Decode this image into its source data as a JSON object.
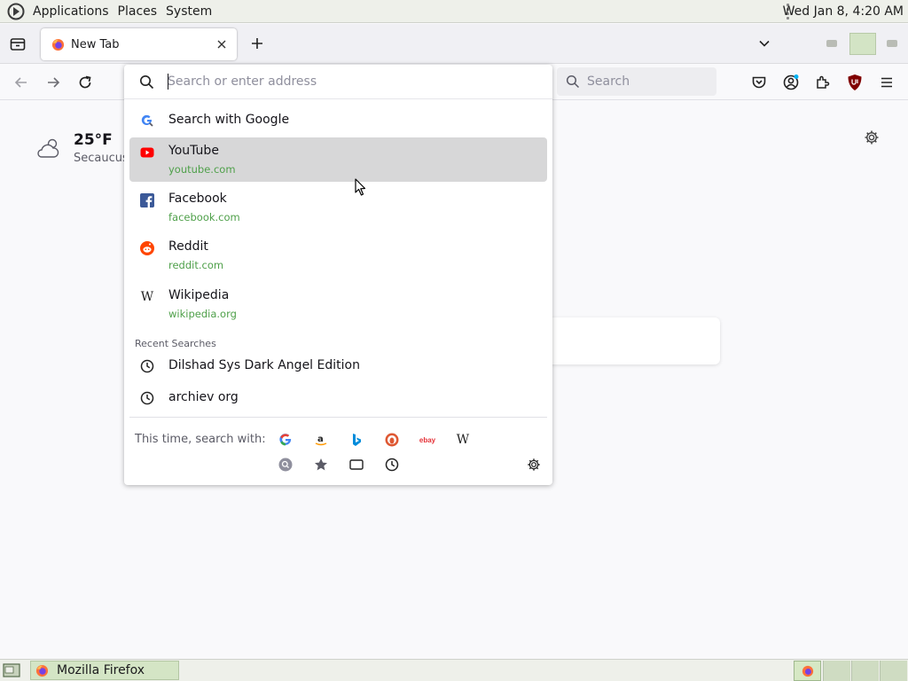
{
  "top_panel": {
    "menus": [
      "Applications",
      "Places",
      "System"
    ],
    "clock": "Wed Jan  8,  4:20 AM"
  },
  "tabs": [
    {
      "title": "New Tab",
      "active": true
    }
  ],
  "toolbar": {
    "search_placeholder": "Search"
  },
  "new_tab_page": {
    "weather": {
      "temperature": "25°F",
      "location": "Secaucus"
    }
  },
  "urlbar": {
    "placeholder": "Search or enter address",
    "value": "",
    "suggestions": [
      {
        "label": "Search with Google",
        "icon": "google-search-icon"
      },
      {
        "label": "YouTube",
        "url": "youtube.com",
        "icon": "youtube-icon",
        "selected": true
      },
      {
        "label": "Facebook",
        "url": "facebook.com",
        "icon": "facebook-icon"
      },
      {
        "label": "Reddit",
        "url": "reddit.com",
        "icon": "reddit-icon"
      },
      {
        "label": "Wikipedia",
        "url": "wikipedia.org",
        "icon": "wikipedia-icon"
      }
    ],
    "recent_heading": "Recent Searches",
    "recent_searches": [
      "Dilshad Sys Dark Angel Edition",
      "archiev org"
    ],
    "one_off_label": "This time, search with:",
    "one_off_engines": [
      "Google",
      "Amazon",
      "Bing",
      "DuckDuckGo",
      "eBay",
      "Wikipedia"
    ],
    "one_off_engine_glyphs": {
      "wikipedia": "W",
      "ebay": "ebay"
    }
  },
  "taskbar": {
    "window_title": "Mozilla Firefox",
    "workspaces": 4
  },
  "colors": {
    "url_green": "#4fa04a",
    "selected_row": "#d7d7d8",
    "youtube_red": "#ff0000",
    "facebook_blue": "#1877f2",
    "reddit_orange": "#ff4500",
    "ublock_red": "#800000"
  }
}
